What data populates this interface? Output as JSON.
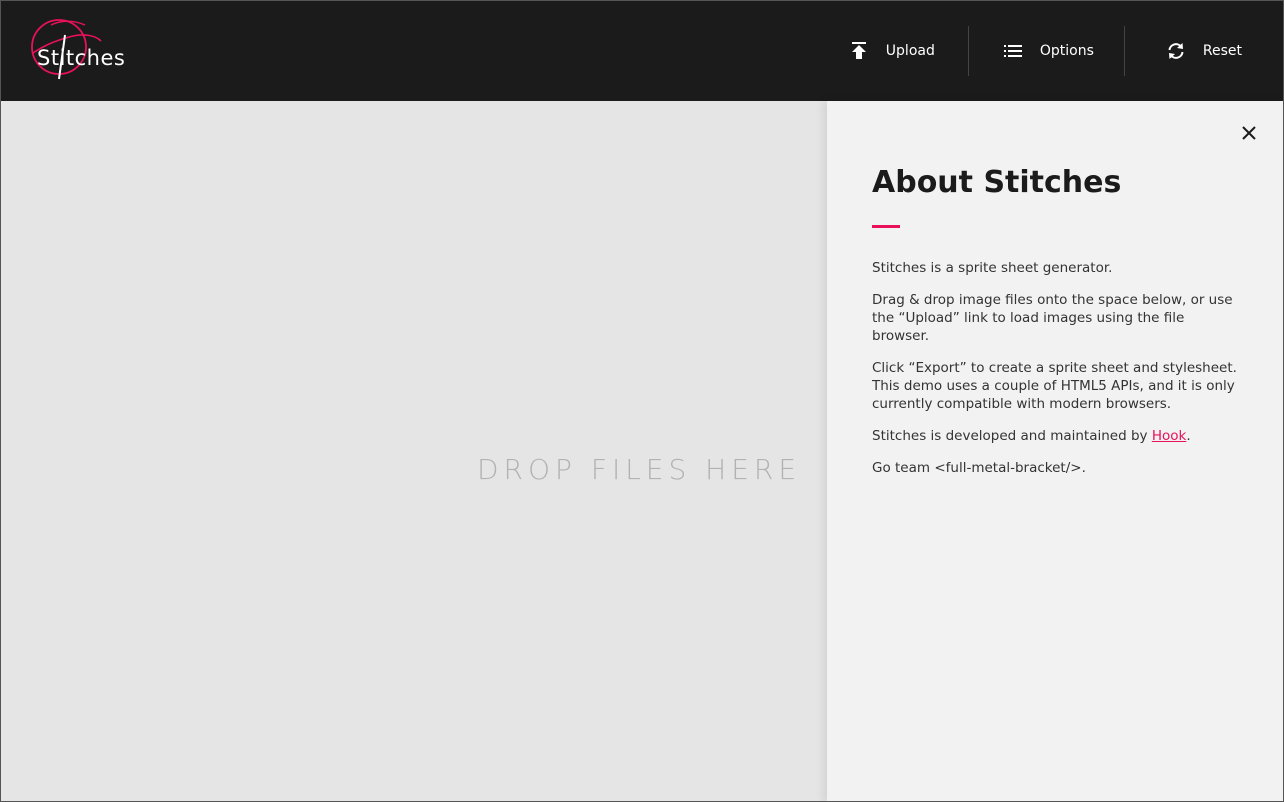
{
  "app": {
    "logo_text": "Stitches"
  },
  "nav": {
    "upload": {
      "label": "Upload",
      "icon": "upload-icon"
    },
    "options": {
      "label": "Options",
      "icon": "list-icon"
    },
    "reset": {
      "label": "Reset",
      "icon": "refresh-icon"
    }
  },
  "dropzone": {
    "text": "DROP FILES HERE"
  },
  "about": {
    "title": "About Stitches",
    "p1": "Stitches is a sprite sheet generator.",
    "p2": "Drag & drop image files onto the space below, or use the “Upload” link to load images using the file browser.",
    "p3": "Click “Export” to create a sprite sheet and stylesheet. This demo uses a couple of HTML5 APIs, and it is only currently compatible with modern browsers.",
    "p4_prefix": "Stitches is developed and maintained by ",
    "p4_link": "Hook",
    "p4_suffix": ".",
    "p5": "Go team <full-metal-bracket/>."
  },
  "colors": {
    "accent": "#e8115a",
    "header_bg": "#1b1b1b",
    "panel_bg": "#f2f2f2",
    "dropzone_bg": "#e5e5e5"
  }
}
